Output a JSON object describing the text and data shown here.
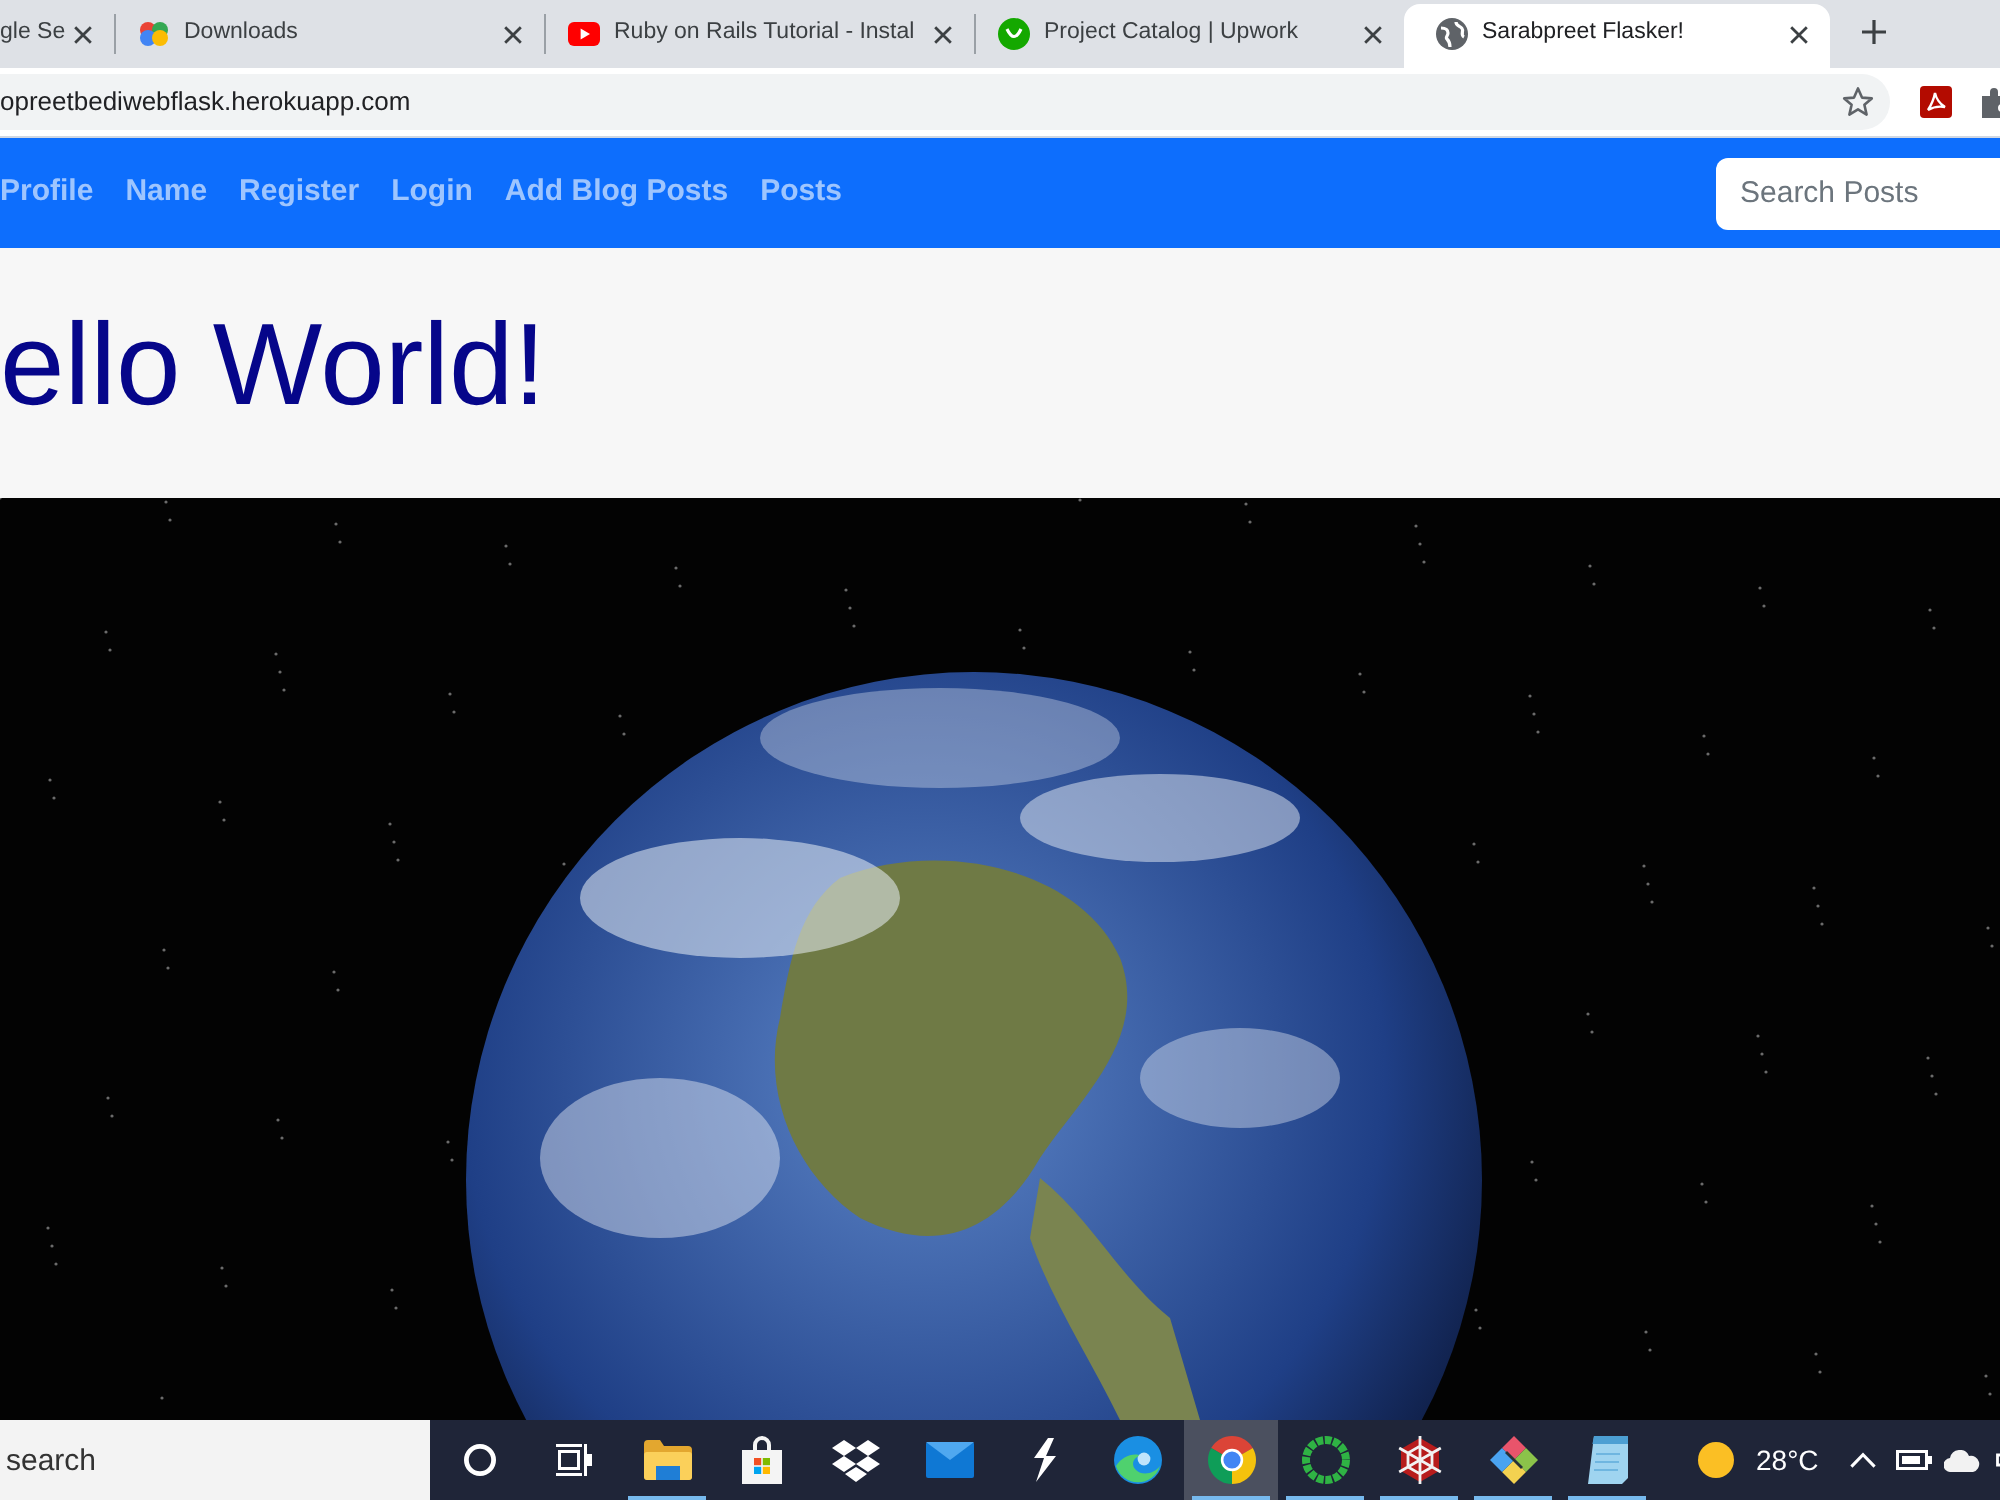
{
  "browser": {
    "tabs": [
      {
        "kind": "none",
        "title": "gle Se",
        "selected": false
      },
      {
        "kind": "drive",
        "title": "Downloads",
        "selected": false
      },
      {
        "kind": "youtube",
        "title": "Ruby on Rails Tutorial - Instal",
        "selected": false
      },
      {
        "kind": "upwork",
        "title": "Project Catalog | Upwork",
        "selected": false
      },
      {
        "kind": "globe",
        "title": "Sarabpreet Flasker!",
        "selected": true
      }
    ],
    "address": "opreetbediwebflask.herokuapp.com"
  },
  "navbar": {
    "links": [
      "Profile",
      "Name",
      "Register",
      "Login",
      "Add Blog Posts",
      "Posts"
    ],
    "search": {
      "placeholder": "Search Posts"
    }
  },
  "hero": {
    "heading": "ello World!"
  },
  "taskbar": {
    "search": {
      "placeholder": "search"
    },
    "apps": [
      {
        "kind": "cortana",
        "running": false,
        "selected": false
      },
      {
        "kind": "taskview",
        "running": false,
        "selected": false
      },
      {
        "kind": "explorer",
        "running": true,
        "selected": false
      },
      {
        "kind": "store",
        "running": false,
        "selected": false
      },
      {
        "kind": "dropbox",
        "running": false,
        "selected": false
      },
      {
        "kind": "mail",
        "running": false,
        "selected": false
      },
      {
        "kind": "bolt",
        "running": false,
        "selected": false
      },
      {
        "kind": "edge",
        "running": false,
        "selected": false
      },
      {
        "kind": "chrome",
        "running": true,
        "selected": true
      },
      {
        "kind": "ring",
        "running": true,
        "selected": false
      },
      {
        "kind": "web",
        "running": true,
        "selected": false
      },
      {
        "kind": "diamond",
        "running": true,
        "selected": false
      },
      {
        "kind": "notepad",
        "running": true,
        "selected": false
      }
    ],
    "weather": "28°C"
  }
}
